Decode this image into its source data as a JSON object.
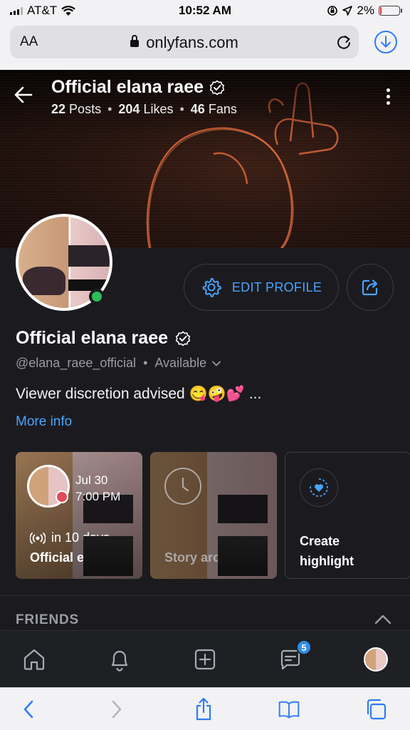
{
  "status_bar": {
    "carrier": "AT&T",
    "time": "10:52 AM",
    "battery": "2%"
  },
  "browser": {
    "aa_label": "AA",
    "url": "onlyfans.com"
  },
  "header": {
    "title": "Official elana raee",
    "posts_count": "22",
    "posts_label": "Posts",
    "likes_count": "204",
    "likes_label": "Likes",
    "fans_count": "46",
    "fans_label": "Fans",
    "separator": "•"
  },
  "profile": {
    "edit_button": "EDIT PROFILE",
    "name": "Official elana raee",
    "handle": "@elana_raee_official",
    "separator": "•",
    "availability": "Available",
    "bio": "Viewer discretion advised 😋🤪💕 ...",
    "more_info": "More info"
  },
  "highlights": [
    {
      "date": "Jul 30",
      "time": "7:00 PM",
      "live_text": "in 10 days",
      "label": "Official el..."
    },
    {
      "label": "Story archive"
    },
    {
      "label_line1": "Create",
      "label_line2": "highlight"
    }
  ],
  "section": {
    "friends_title": "FRIENDS"
  },
  "bottom_nav": {
    "messages_badge": "5"
  },
  "colors": {
    "accent": "#4aa3ff",
    "background": "#1b1b1f",
    "online": "#2dbd5a",
    "badge": "#2f8de5"
  }
}
